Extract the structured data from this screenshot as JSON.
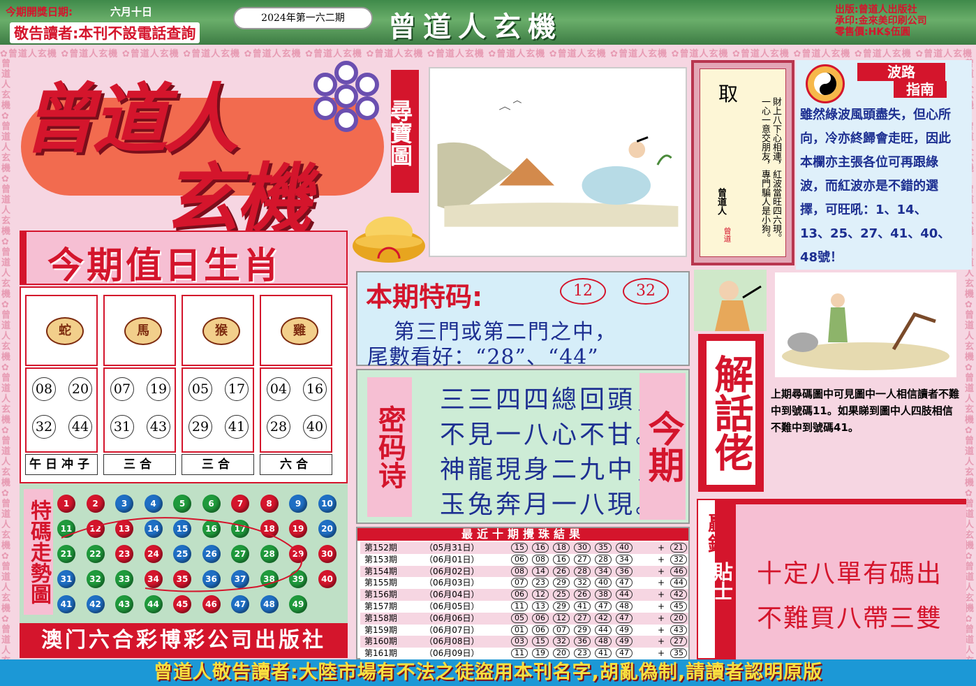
{
  "header": {
    "date_label": "今期開獎日期:",
    "date": "六月十日",
    "notice": "敬告讀者:本刊不設電話查詢",
    "issue": "2024年第一六二期",
    "title": "曾道人玄機",
    "publisher": "出版:曾道人出版社",
    "printer": "承印:金來美印刷公司",
    "price": "零售價:HK$伍圓"
  },
  "watermark": "曾道人玄機",
  "logo": {
    "line1": "曾道人",
    "line2": "玄機",
    "treasure_label": "尋寶圖"
  },
  "poem": {
    "char": "取",
    "text": "財上八下心相連，紅波當旺四六現。一心一意交朋友，專門騙人是小狗。",
    "signature": "曾道人",
    "seal": "曾道"
  },
  "guide": {
    "title1": "波路",
    "title2": "指南",
    "body": "雖然綠波風頭盡失，但心所向，冷亦終歸會走旺，因此本欄亦主張各位可再跟綠波，而紅波亦是不錯的選擇，可旺吼：1、14、13、25、27、41、40、48號！"
  },
  "zodiac": {
    "title": "今期值日生肖",
    "items": [
      {
        "animal": "蛇",
        "numbers": [
          "08",
          "20",
          "32",
          "44"
        ],
        "label": "午日冲子"
      },
      {
        "animal": "馬",
        "numbers": [
          "07",
          "19",
          "31",
          "43"
        ],
        "label": "三合"
      },
      {
        "animal": "猴",
        "numbers": [
          "05",
          "17",
          "29",
          "41"
        ],
        "label": "三合"
      },
      {
        "animal": "雞",
        "numbers": [
          "04",
          "16",
          "28",
          "40"
        ],
        "label": "六合"
      }
    ]
  },
  "trend": {
    "label": "特碼走勢圖",
    "rows": [
      [
        1,
        2,
        3,
        4,
        5,
        6,
        7,
        8,
        9,
        10
      ],
      [
        11,
        12,
        13,
        14,
        15,
        16,
        17,
        18,
        19,
        20
      ],
      [
        21,
        22,
        23,
        24,
        25,
        26,
        27,
        28,
        29,
        30
      ],
      [
        31,
        32,
        33,
        34,
        35,
        36,
        37,
        38,
        39,
        40
      ],
      [
        41,
        42,
        43,
        44,
        45,
        46,
        47,
        48,
        49
      ]
    ],
    "colors": {
      "red": "#d4152c",
      "blue": "#1f6fc4",
      "green": "#1f9a3c"
    },
    "red_numbers": [
      1,
      2,
      7,
      8,
      12,
      13,
      18,
      19,
      23,
      24,
      29,
      30,
      34,
      35,
      40,
      45,
      46
    ],
    "blue_numbers": [
      3,
      4,
      9,
      10,
      14,
      15,
      20,
      25,
      26,
      31,
      36,
      37,
      41,
      42,
      47,
      48
    ],
    "green_numbers": [
      5,
      6,
      11,
      16,
      17,
      21,
      22,
      27,
      28,
      32,
      33,
      38,
      39,
      43,
      44,
      49
    ]
  },
  "publisher": "澳门六合彩博彩公司出版社",
  "special": {
    "title": "本期特码:",
    "numbers": [
      "12",
      "32"
    ],
    "line1": "第三門或第二門之中，",
    "line2": "尾數看好：“28”、“44”"
  },
  "secret": {
    "left": "密码诗",
    "right": "今期",
    "lines": [
      "三三四四總回頭，",
      "不見一八心不甘。",
      "神龍現身二九中，",
      "玉兔奔月一八現。"
    ]
  },
  "results": {
    "title": "最近十期攪珠結果",
    "rows": [
      {
        "issue": "第152期",
        "date": "（05月31日）",
        "nums": [
          "15",
          "16",
          "18",
          "30",
          "35",
          "40"
        ],
        "special": "21"
      },
      {
        "issue": "第153期",
        "date": "（06月01日）",
        "nums": [
          "06",
          "08",
          "16",
          "27",
          "28",
          "34"
        ],
        "special": "32"
      },
      {
        "issue": "第154期",
        "date": "（06月02日）",
        "nums": [
          "08",
          "14",
          "26",
          "28",
          "34",
          "36"
        ],
        "special": "46"
      },
      {
        "issue": "第155期",
        "date": "（06月03日）",
        "nums": [
          "07",
          "23",
          "29",
          "32",
          "40",
          "47"
        ],
        "special": "44"
      },
      {
        "issue": "第156期",
        "date": "（06月04日）",
        "nums": [
          "06",
          "12",
          "25",
          "26",
          "38",
          "44"
        ],
        "special": "42"
      },
      {
        "issue": "第157期",
        "date": "（06月05日）",
        "nums": [
          "11",
          "13",
          "29",
          "41",
          "47",
          "48"
        ],
        "special": "45"
      },
      {
        "issue": "第158期",
        "date": "（06月06日）",
        "nums": [
          "05",
          "06",
          "12",
          "27",
          "42",
          "47"
        ],
        "special": "20"
      },
      {
        "issue": "第159期",
        "date": "（06月07日）",
        "nums": [
          "01",
          "06",
          "07",
          "29",
          "44",
          "49"
        ],
        "special": "43"
      },
      {
        "issue": "第160期",
        "date": "（06月08日）",
        "nums": [
          "03",
          "15",
          "32",
          "36",
          "48",
          "49"
        ],
        "special": "27"
      },
      {
        "issue": "第161期",
        "date": "（06月09日）",
        "nums": [
          "11",
          "19",
          "20",
          "23",
          "41",
          "47"
        ],
        "special": "35"
      }
    ]
  },
  "talk": {
    "label": "解話佬"
  },
  "lastnote": "上期尋碼圖中可見圖中一人相信讀者不難中到號碼11。如果睇到圖中人四肢相信不難中到號碼41。",
  "tips": {
    "side1": "贏錢",
    "side2": "貼士",
    "lines": [
      "十定八單有碼出",
      "不難買八帶三雙"
    ]
  },
  "footer": "曾道人敬告讀者:大陸市場有不法之徒盜用本刊名字,胡亂偽制,請讀者認明原版"
}
